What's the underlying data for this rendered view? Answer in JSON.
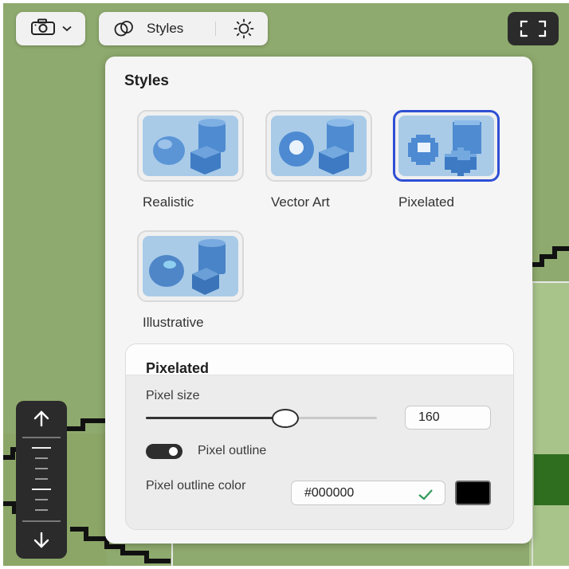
{
  "toolbar": {
    "styles_label": "Styles"
  },
  "panel": {
    "title": "Styles",
    "styles": [
      {
        "label": "Realistic",
        "selected": false,
        "icon": "realistic-shapes-thumbnail"
      },
      {
        "label": "Vector Art",
        "selected": false,
        "icon": "vector-shapes-thumbnail"
      },
      {
        "label": "Pixelated",
        "selected": true,
        "icon": "pixelated-shapes-thumbnail"
      },
      {
        "label": "Illustrative",
        "selected": false,
        "icon": "illustrative-shapes-thumbnail"
      }
    ],
    "settings": {
      "title": "Pixelated",
      "pixel_size_label": "Pixel size",
      "pixel_size_value": "160",
      "pixel_size_level": 0.6,
      "outline_label": "Pixel outline",
      "outline_enabled": true,
      "outline_color_label": "Pixel outline color",
      "outline_color_value": "#000000",
      "outline_color_swatch": "#000000"
    }
  },
  "colors": {
    "accent": "#2f4fd4",
    "canvas": "#8faa6e"
  }
}
